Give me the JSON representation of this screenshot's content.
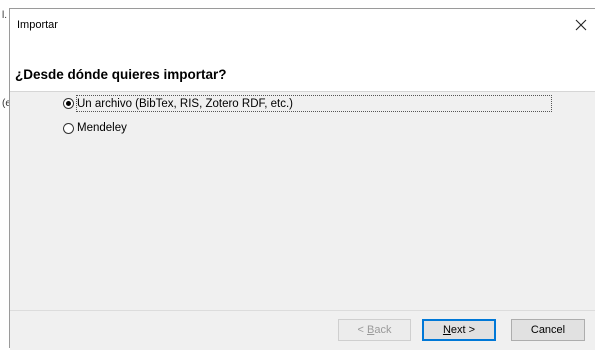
{
  "background": {
    "glyph_top": "l.",
    "glyph_mid": "(e"
  },
  "window": {
    "title": "Importar",
    "close_icon": "close-icon"
  },
  "dialog": {
    "heading": "¿Desde dónde quieres importar?",
    "options": [
      {
        "label": "Un archivo (BibTex, RIS, Zotero RDF, etc.)",
        "selected": true
      },
      {
        "label": "Mendeley",
        "selected": false
      }
    ]
  },
  "buttons": {
    "back": {
      "prefix": "< ",
      "mnemonic": "B",
      "rest": "ack",
      "enabled": false
    },
    "next": {
      "mnemonic": "N",
      "rest": "ext >",
      "default": true
    },
    "cancel": "Cancel"
  },
  "colors": {
    "accent": "#0078d7",
    "content_bg": "#f0f0f0"
  }
}
